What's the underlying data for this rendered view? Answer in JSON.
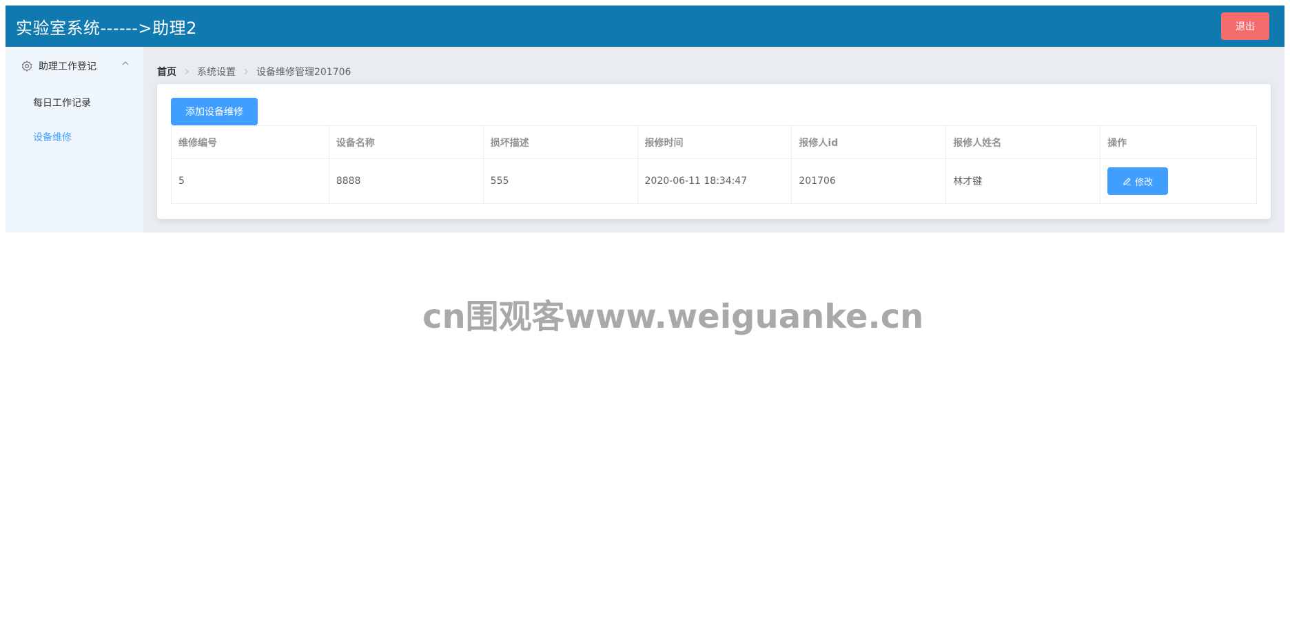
{
  "header": {
    "title": "实验室系统------>助理2",
    "logout_label": "退出"
  },
  "sidebar": {
    "group": {
      "label": "助理工作登记",
      "icon": "gear-icon",
      "expand_icon": "chevron-up-icon"
    },
    "items": [
      {
        "label": "每日工作记录",
        "active": false
      },
      {
        "label": "设备维修",
        "active": true
      }
    ]
  },
  "breadcrumb": [
    "首页",
    "系统设置",
    "设备维修管理201706"
  ],
  "toolbar": {
    "add_label": "添加设备维修"
  },
  "table": {
    "columns": [
      "维修编号",
      "设备名称",
      "损坏描述",
      "报修时间",
      "报修人id",
      "报修人姓名",
      "操作"
    ],
    "rows": [
      {
        "id": "5",
        "device": "8888",
        "description": "555",
        "time": "2020-06-11 18:34:47",
        "reporter_id": "201706",
        "reporter_name": "林才键",
        "action_label": "修改"
      }
    ]
  },
  "watermark": "cn围观客www.weiguanke.cn",
  "colors": {
    "header_bg": "#1079b0",
    "logout": "#f56c6c",
    "primary": "#409eff",
    "sidebar_bg": "#f0f7fc",
    "main_bg": "#e9edf1"
  }
}
